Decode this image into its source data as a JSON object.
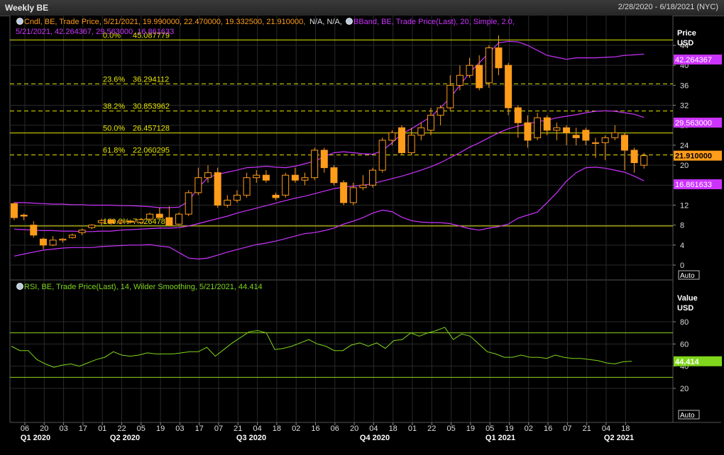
{
  "header": {
    "title": "Weekly BE",
    "date_range": "2/28/2020 - 6/18/2021 (NYC)"
  },
  "legends": {
    "candle_line1_a": "Cndl, BE, Trade Price, 5/21/2021, 19.990000, 22.470000, 19.332500, 21.910000,",
    "candle_line1_b": "N/A, N/A,",
    "bband_line1": "BBand, BE, Trade Price(Last), 20, Simple, 2.0,",
    "bband_line2": "5/21/2021, 42.264367, 29.563000, 16.861633",
    "rsi": "RSI, BE, Trade Price(Last), 14, Wilder Smoothing, 5/21/2021, 44.414"
  },
  "axes": {
    "price_title": "Price",
    "price_unit": "USD",
    "value_title": "Value",
    "value_unit": "USD",
    "auto": "Auto",
    "price_ticks": [
      "0",
      "4",
      "8",
      "12",
      "16",
      "20",
      "24",
      "28",
      "32",
      "36",
      "40",
      "44"
    ],
    "rsi_ticks": [
      "20",
      "40",
      "60",
      "80"
    ],
    "x_ticks": [
      "06",
      "20",
      "03",
      "17",
      "01",
      "22",
      "05",
      "19",
      "03",
      "17",
      "07",
      "21",
      "04",
      "18",
      "02",
      "16",
      "06",
      "20",
      "04",
      "18",
      "01",
      "22",
      "05",
      "19",
      "05",
      "19",
      "02",
      "16",
      "07",
      "21",
      "04",
      "18"
    ],
    "quarters": [
      "Q1 2020",
      "Q2 2020",
      "Q3 2020",
      "Q4 2020",
      "Q1 2021",
      "Q2 2021"
    ]
  },
  "badges": {
    "bb_upper": "42.264367",
    "bb_mid": "29.563000",
    "last_price": "21.910000",
    "bb_lower": "16.861633",
    "rsi_last": "44.414"
  },
  "fibonacci": [
    {
      "pct": "0.0%",
      "value": "45.087779"
    },
    {
      "pct": "23.6%",
      "value": "36.294112"
    },
    {
      "pct": "38.2%",
      "value": "30.853962"
    },
    {
      "pct": "50.0%",
      "value": "26.457128"
    },
    {
      "pct": "61.8%",
      "value": "22.060295"
    },
    {
      "pct": "100.0%",
      "value": "7.826478"
    }
  ],
  "colors": {
    "candle": "#ff9c1a",
    "bband": "#cc33ff",
    "fib": "#e6e600",
    "rsi": "#7fd61c",
    "rsi_bands": "#8fd61c",
    "grid": "#2a2a2a",
    "bg": "#000000"
  },
  "chart_data": [
    {
      "type": "candlestick",
      "title": "Weekly BE",
      "ylabel": "Price USD",
      "ylim": [
        0,
        46
      ],
      "candles": [
        [
          12.3,
          12.5,
          9.0,
          9.5
        ],
        [
          10.0,
          10.3,
          9.0,
          9.8
        ],
        [
          8.0,
          8.8,
          5.5,
          6.0
        ],
        [
          5.2,
          5.5,
          3.2,
          4.0
        ],
        [
          4.0,
          5.8,
          3.8,
          5.0
        ],
        [
          5.0,
          5.4,
          4.5,
          5.2
        ],
        [
          5.5,
          6.3,
          5.3,
          6.0
        ],
        [
          6.5,
          7.3,
          6.0,
          7.0
        ],
        [
          7.5,
          8.2,
          7.2,
          8.0
        ],
        [
          8.5,
          9.3,
          8.0,
          8.9
        ],
        [
          9.0,
          9.3,
          8.1,
          8.4
        ],
        [
          8.5,
          9.0,
          8.2,
          8.8
        ],
        [
          8.8,
          9.1,
          8.3,
          8.6
        ],
        [
          8.6,
          9.3,
          8.4,
          9.1
        ],
        [
          9.2,
          10.5,
          9.0,
          10.2
        ],
        [
          10.2,
          11.5,
          9.8,
          9.5
        ],
        [
          9.5,
          11.8,
          9.2,
          8.0
        ],
        [
          8.2,
          10.5,
          8.0,
          10.2
        ],
        [
          10.2,
          15.0,
          9.8,
          14.5
        ],
        [
          14.5,
          19.5,
          14.0,
          17.5
        ],
        [
          17.5,
          20.0,
          16.5,
          18.5
        ],
        [
          18.5,
          19.5,
          11.5,
          12.0
        ],
        [
          12.0,
          14.0,
          11.5,
          13.0
        ],
        [
          13.0,
          15.0,
          12.5,
          14.0
        ],
        [
          14.0,
          18.5,
          13.5,
          17.5
        ],
        [
          17.5,
          19.0,
          16.5,
          18.0
        ],
        [
          18.0,
          19.0,
          16.5,
          17.0
        ],
        [
          14.0,
          14.5,
          13.0,
          13.5
        ],
        [
          14.0,
          18.5,
          13.5,
          18.0
        ],
        [
          18.0,
          19.5,
          16.5,
          17.0
        ],
        [
          17.0,
          18.5,
          16.0,
          17.5
        ],
        [
          17.5,
          23.5,
          17.0,
          23.0
        ],
        [
          23.0,
          23.5,
          18.5,
          19.5
        ],
        [
          19.5,
          20.0,
          16.0,
          16.5
        ],
        [
          16.5,
          17.0,
          12.0,
          12.5
        ],
        [
          12.5,
          16.5,
          12.0,
          15.5
        ],
        [
          15.5,
          18.0,
          15.0,
          16.0
        ],
        [
          16.0,
          19.5,
          15.5,
          19.0
        ],
        [
          19.0,
          25.5,
          18.5,
          25.0
        ],
        [
          25.0,
          27.0,
          24.0,
          26.5
        ],
        [
          27.5,
          28.0,
          22.0,
          22.5
        ],
        [
          22.5,
          27.5,
          22.0,
          26.0
        ],
        [
          26.0,
          28.5,
          25.0,
          27.5
        ],
        [
          27.0,
          31.5,
          26.0,
          30.0
        ],
        [
          30.0,
          32.0,
          28.0,
          31.5
        ],
        [
          31.5,
          38.0,
          31.0,
          36.0
        ],
        [
          36.0,
          40.0,
          35.0,
          38.0
        ],
        [
          38.0,
          41.5,
          37.5,
          40.0
        ],
        [
          40.0,
          42.0,
          35.0,
          35.5
        ],
        [
          36.5,
          44.0,
          35.5,
          43.5
        ],
        [
          43.5,
          46.0,
          38.0,
          39.5
        ],
        [
          40.0,
          40.5,
          30.0,
          31.5
        ],
        [
          31.5,
          32.0,
          25.5,
          28.5
        ],
        [
          28.5,
          30.0,
          23.5,
          25.0
        ],
        [
          25.5,
          30.5,
          25.0,
          29.5
        ],
        [
          29.5,
          30.0,
          26.0,
          27.0
        ],
        [
          27.0,
          28.5,
          25.0,
          27.5
        ],
        [
          27.5,
          28.0,
          24.0,
          26.5
        ],
        [
          26.0,
          27.5,
          24.0,
          25.5
        ],
        [
          27.0,
          27.5,
          24.0,
          25.0
        ],
        [
          24.5,
          25.5,
          21.5,
          24.5
        ],
        [
          24.5,
          26.0,
          21.0,
          25.5
        ],
        [
          25.5,
          28.0,
          25.0,
          26.5
        ],
        [
          26.0,
          26.5,
          19.0,
          23.0
        ],
        [
          23.0,
          23.5,
          18.5,
          20.5
        ],
        [
          19.99,
          22.47,
          19.3325,
          21.91
        ]
      ],
      "bband_upper": [
        12.5,
        12.5,
        12.4,
        12.3,
        12.2,
        12.2,
        12.1,
        12.1,
        12.0,
        12.0,
        12.0,
        11.9,
        11.9,
        11.8,
        11.7,
        11.5,
        11.5,
        11.6,
        12.8,
        15.5,
        17.5,
        18.2,
        18.6,
        19.0,
        19.5,
        19.6,
        19.8,
        19.6,
        19.5,
        19.8,
        20.3,
        20.8,
        21.7,
        22.5,
        22.7,
        22.5,
        22.3,
        22.2,
        22.9,
        24.5,
        26.3,
        27.3,
        28.5,
        29.7,
        31.5,
        33.5,
        36.0,
        38.5,
        40.5,
        42.5,
        44.5,
        44.8,
        44.7,
        44.0,
        43.0,
        42.0,
        41.6,
        41.2,
        41.5,
        41.5,
        41.5,
        41.6,
        41.7,
        42.0,
        42.1,
        42.26
      ],
      "bband_mid": [
        7.2,
        7.1,
        7.0,
        6.9,
        6.9,
        6.8,
        6.8,
        6.7,
        6.7,
        6.8,
        6.8,
        7.0,
        7.1,
        7.2,
        7.3,
        7.4,
        7.4,
        7.5,
        7.8,
        8.3,
        8.8,
        9.3,
        9.8,
        10.4,
        10.9,
        11.4,
        11.9,
        12.4,
        12.9,
        13.4,
        13.8,
        14.3,
        14.8,
        15.3,
        15.6,
        15.8,
        16.0,
        16.3,
        16.8,
        17.3,
        17.8,
        18.4,
        19.0,
        19.7,
        20.5,
        21.5,
        22.5,
        23.6,
        24.5,
        25.5,
        26.5,
        27.3,
        27.8,
        28.3,
        28.7,
        29.0,
        29.5,
        29.8,
        30.1,
        30.5,
        30.8,
        30.9,
        30.8,
        30.5,
        30.2,
        29.56
      ],
      "bband_lower": [
        1.8,
        2.2,
        2.6,
        3.0,
        3.2,
        3.4,
        3.5,
        3.5,
        3.5,
        3.7,
        3.8,
        3.9,
        4.0,
        4.0,
        4.1,
        3.8,
        3.6,
        2.5,
        1.4,
        1.2,
        1.4,
        2.0,
        2.6,
        3.1,
        3.6,
        4.1,
        4.4,
        4.8,
        5.3,
        5.8,
        6.3,
        6.5,
        6.9,
        7.4,
        8.2,
        8.8,
        9.5,
        10.4,
        11.0,
        10.7,
        9.6,
        8.9,
        8.6,
        8.5,
        8.5,
        8.3,
        7.8,
        7.3,
        7.0,
        7.4,
        7.7,
        8.2,
        9.4,
        10.0,
        10.6,
        12.5,
        14.5,
        16.8,
        18.5,
        19.5,
        19.6,
        19.4,
        19.0,
        18.6,
        17.8,
        16.86
      ],
      "fib_levels": [
        45.087779,
        36.294112,
        30.853962,
        26.457128,
        22.060295,
        7.826478
      ],
      "last_price": 21.91
    },
    {
      "type": "line",
      "title": "RSI",
      "ylabel": "Value USD",
      "ylim": [
        10,
        92
      ],
      "band_levels": [
        70,
        30
      ],
      "series": [
        {
          "name": "RSI",
          "values": [
            58,
            54,
            54,
            46,
            42,
            39,
            41,
            42,
            40,
            43,
            46,
            48,
            53,
            50,
            49,
            50,
            52,
            51,
            51,
            51,
            52,
            53,
            53,
            57,
            49,
            55,
            61,
            66,
            71,
            72,
            70,
            55,
            56,
            58,
            61,
            64,
            60,
            58,
            54,
            54,
            59,
            61,
            58,
            61,
            56,
            63,
            64,
            70,
            67,
            70,
            72,
            75,
            64,
            69,
            67,
            60,
            53,
            51,
            48,
            48,
            50,
            48,
            48,
            47,
            50,
            48,
            47,
            47,
            46,
            45,
            43,
            42,
            44,
            44.414
          ]
        }
      ],
      "x_index_note_values": []
    }
  ]
}
